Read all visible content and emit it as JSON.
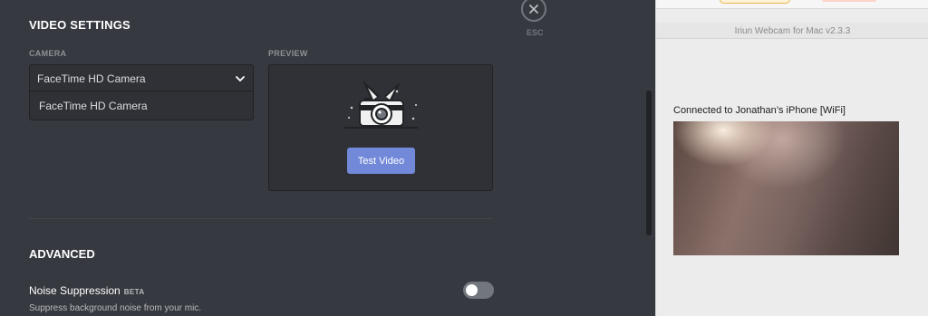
{
  "discord": {
    "video_settings_heading": "VIDEO SETTINGS",
    "camera_label": "CAMERA",
    "preview_label": "PREVIEW",
    "camera_selected": "FaceTime HD Camera",
    "camera_options": [
      "FaceTime HD Camera"
    ],
    "test_video_button": "Test Video",
    "advanced_heading": "ADVANCED",
    "noise_suppression_label": "Noise Suppression",
    "beta_badge": "BETA",
    "noise_suppression_desc": "Suppress background noise from your mic.",
    "noise_suppression_enabled": false,
    "close_label": "ESC"
  },
  "iriun": {
    "window_title": "Iriun Webcam for Mac v2.3.3",
    "connection_status": "Connected to Jonathan’s iPhone [WiFi]"
  },
  "icons": {
    "close": "close-icon",
    "chevron": "chevron-down-icon",
    "camera_illustration": "camera-illustration"
  },
  "colors": {
    "accent": "#7289da",
    "background": "#36393f",
    "panel": "#2f3136"
  }
}
